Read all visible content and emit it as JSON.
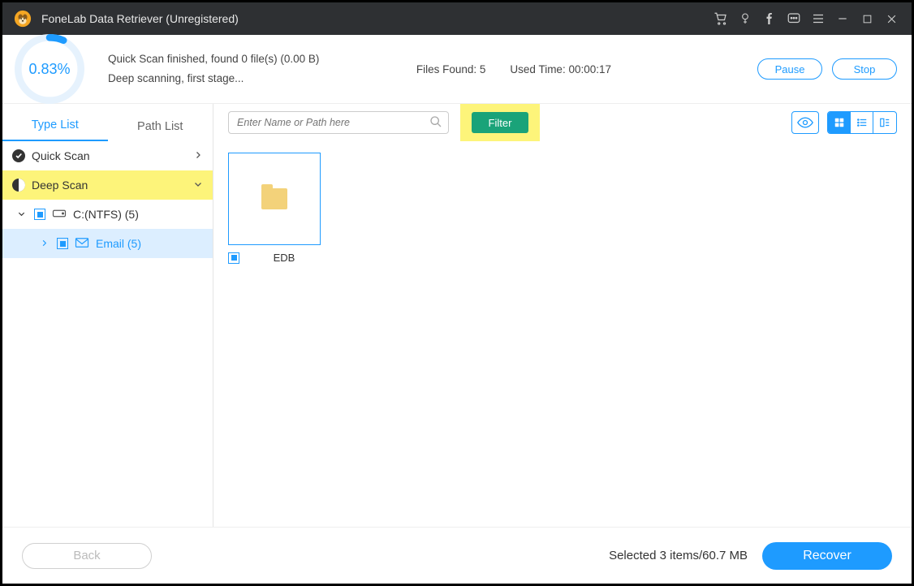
{
  "title": "FoneLab Data Retriever (Unregistered)",
  "status": {
    "percent": "0.83%",
    "line1": "Quick Scan finished, found 0 file(s) (0.00  B)",
    "line2": "Deep scanning, first stage...",
    "files_found_label": "Files Found: 5",
    "used_time_label": "Used Time: 00:00:17",
    "pause": "Pause",
    "stop": "Stop"
  },
  "sidebar": {
    "tab_type": "Type List",
    "tab_path": "Path List",
    "quick_scan": "Quick Scan",
    "deep_scan": "Deep Scan",
    "drive": "C:(NTFS) (5)",
    "email": "Email (5)"
  },
  "toolbar": {
    "search_placeholder": "Enter Name or Path here",
    "filter": "Filter"
  },
  "grid": {
    "item0_label": "EDB"
  },
  "footer": {
    "back": "Back",
    "selected": "Selected 3 items/60.7 MB",
    "recover": "Recover"
  }
}
